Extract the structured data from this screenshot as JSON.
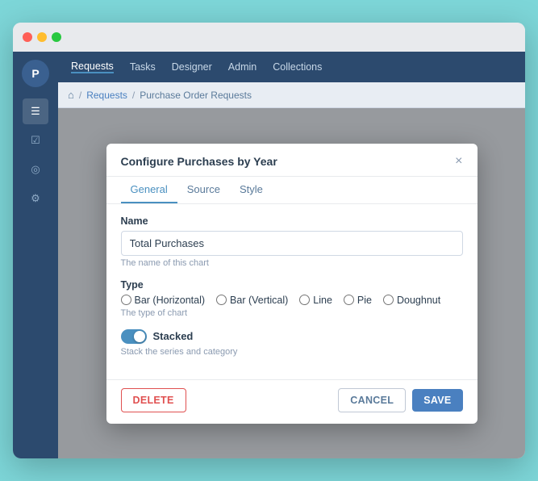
{
  "app": {
    "title": "Configure Purchases by Year",
    "close_label": "×"
  },
  "traffic_lights": {
    "red": "red",
    "yellow": "yellow",
    "green": "green"
  },
  "nav": {
    "items": [
      {
        "label": "Requests",
        "active": true
      },
      {
        "label": "Tasks",
        "active": false
      },
      {
        "label": "Designer",
        "active": false
      },
      {
        "label": "Admin",
        "active": false
      },
      {
        "label": "Collections",
        "active": false
      }
    ]
  },
  "breadcrumb": {
    "home_icon": "🏠",
    "separator": "/",
    "links": [
      {
        "label": "Requests"
      },
      {
        "label": "Purchase Order Requests"
      }
    ]
  },
  "sidebar": {
    "logo": "P",
    "icons": [
      {
        "name": "list-icon",
        "symbol": "≡"
      },
      {
        "name": "check-icon",
        "symbol": "☑"
      },
      {
        "name": "user-icon",
        "symbol": "◎"
      },
      {
        "name": "gear-icon",
        "symbol": "⚙"
      }
    ]
  },
  "modal": {
    "title": "Configure Purchases by Year",
    "close": "×",
    "tabs": [
      {
        "label": "General",
        "active": true
      },
      {
        "label": "Source",
        "active": false
      },
      {
        "label": "Style",
        "active": false
      }
    ],
    "form": {
      "name_label": "Name",
      "name_value": "Total Purchases",
      "name_hint": "The name of this chart",
      "type_label": "Type",
      "type_hint": "The type of chart",
      "type_options": [
        {
          "label": "Bar (Horizontal)",
          "value": "bar-h",
          "checked": false
        },
        {
          "label": "Bar (Vertical)",
          "value": "bar-v",
          "checked": false
        },
        {
          "label": "Line",
          "value": "line",
          "checked": false
        },
        {
          "label": "Pie",
          "value": "pie",
          "checked": false
        },
        {
          "label": "Doughnut",
          "value": "doughnut",
          "checked": false
        }
      ],
      "stacked_label": "Stacked",
      "stacked_hint": "Stack the series and category"
    },
    "footer": {
      "delete_label": "DELETE",
      "cancel_label": "CANCEL",
      "save_label": "SAVE"
    }
  }
}
